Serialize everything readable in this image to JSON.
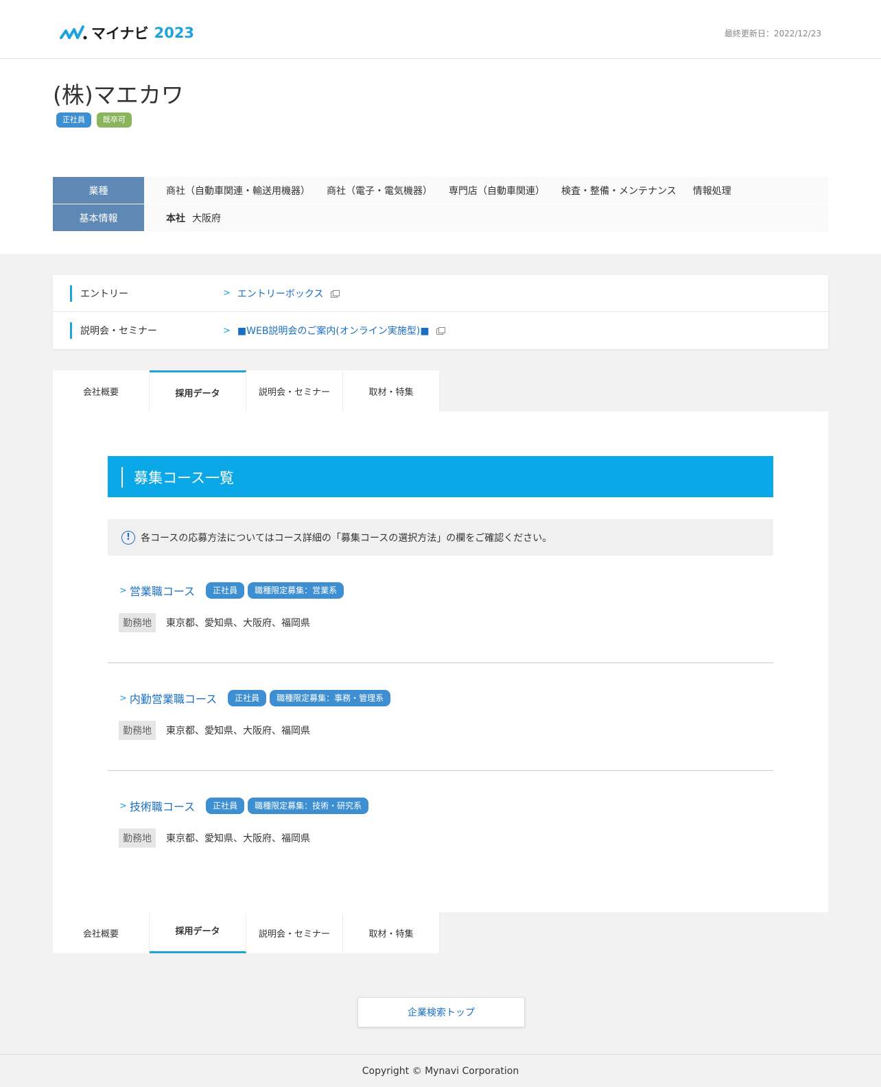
{
  "header": {
    "logo_text": "マイナビ",
    "logo_year": "2023",
    "updated": "最終更新日：2022/12/23"
  },
  "company": {
    "name": "(株)マエカワ",
    "badges": [
      "正社員",
      "既卒可"
    ]
  },
  "info": {
    "industry_label": "業種",
    "industries": [
      "商社（自動車関連・輸送用機器）",
      "商社（電子・電気機器）",
      "専門店（自動車関連）",
      "検査・整備・メンテナンス",
      "情報処理"
    ],
    "basic_label": "基本情報",
    "hq_label": "本社",
    "hq_value": "大阪府"
  },
  "links": {
    "entry_label": "エントリー",
    "entry_link": "エントリーボックス",
    "seminar_label": "説明会・セミナー",
    "seminar_link": "■WEB説明会のご案内(オンライン実施型)■"
  },
  "tabs": [
    "会社概要",
    "採用データ",
    "説明会・セミナー",
    "取材・特集"
  ],
  "active_tab": "採用データ",
  "section": {
    "title": "募集コース一覧",
    "notice": "各コースの応募方法についてはコース詳細の「募集コースの選択方法」の欄をご確認ください。"
  },
  "courses": [
    {
      "title": "営業職コース",
      "badges": [
        "正社員",
        "職種限定募集：営業系"
      ],
      "loc_label": "勤務地",
      "loc": "東京都、愛知県、大阪府、福岡県"
    },
    {
      "title": "内勤営業職コース",
      "badges": [
        "正社員",
        "職種限定募集：事務・管理系"
      ],
      "loc_label": "勤務地",
      "loc": "東京都、愛知県、大阪府、福岡県"
    },
    {
      "title": "技術職コース",
      "badges": [
        "正社員",
        "職種限定募集：技術・研究系"
      ],
      "loc_label": "勤務地",
      "loc": "東京都、愛知県、大阪府、福岡県"
    }
  ],
  "buttons": {
    "top": "企業検索トップ"
  },
  "footer": {
    "copyright": "Copyright © Mynavi Corporation"
  },
  "colors": {
    "accent": "#1aa3dc",
    "link": "#1a6fc4",
    "label_bg": "#5e88b6",
    "badge_blue": "#3d8fd1",
    "badge_green": "#8ab55c"
  }
}
